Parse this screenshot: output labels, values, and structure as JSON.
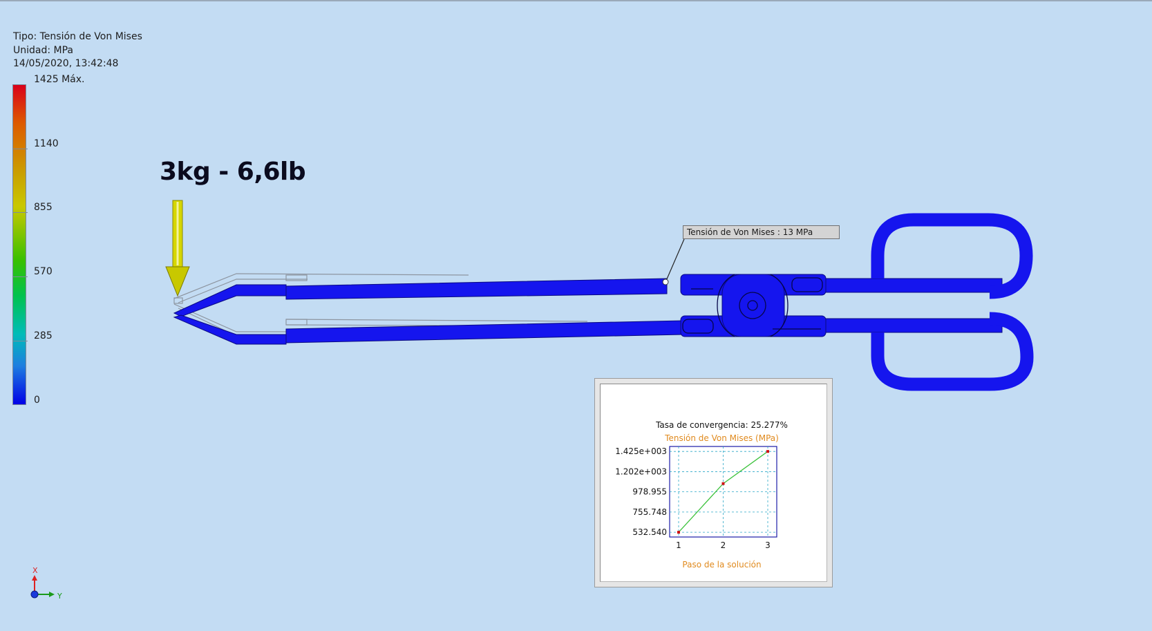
{
  "result_info": {
    "type_line": "Tipo: Tensión de Von Mises",
    "unit_line": "Unidad: MPa",
    "timestamp": "14/05/2020, 13:42:48"
  },
  "legend": {
    "labels": [
      {
        "text": "1425 Máx.",
        "value": 1425
      },
      {
        "text": "1140",
        "value": 1140
      },
      {
        "text": "855",
        "value": 855
      },
      {
        "text": "570",
        "value": 570
      },
      {
        "text": "285",
        "value": 285
      },
      {
        "text": "0",
        "value": 0
      }
    ],
    "colors": [
      "#d9001a",
      "#dd5a00",
      "#c9a100",
      "#c9c800",
      "#38c000",
      "#00c24e",
      "#00bcb8",
      "#1e7ee0",
      "#0000e6"
    ]
  },
  "load": {
    "label": "3kg - 6,6lb",
    "arrow_color": "#d6d600"
  },
  "probe": {
    "label": "Tensión de Von Mises : 13 MPa"
  },
  "model": {
    "color": "#1515ee",
    "engraving_left": "",
    "engraving_right": ""
  },
  "convergence": {
    "rate_line": "Tasa de convergencia: 25.277%",
    "chart_data": {
      "type": "line",
      "title": "Tensión de Von Mises (MPa)",
      "xlabel": "Paso de la solución",
      "ylabel": "",
      "x": [
        1,
        2,
        3
      ],
      "series": [
        {
          "values": [
            532.54,
            1070,
            1425
          ]
        }
      ],
      "y_ticks": [
        {
          "text": "1.425e+003",
          "value": 1425
        },
        {
          "text": "1.202e+003",
          "value": 1202
        },
        {
          "text": "978.955",
          "value": 978.955
        },
        {
          "text": "755.748",
          "value": 755.748
        },
        {
          "text": "532.540",
          "value": 532.54
        }
      ],
      "x_ticks": [
        "1",
        "2",
        "3"
      ],
      "ylim": [
        480,
        1480
      ],
      "grid": true,
      "line_color": "#3cc23c",
      "marker_color": "#d01010",
      "frame_color": "#1a1aa8"
    }
  },
  "axis_triad": {
    "x_label": "X",
    "y_label": "Y"
  }
}
